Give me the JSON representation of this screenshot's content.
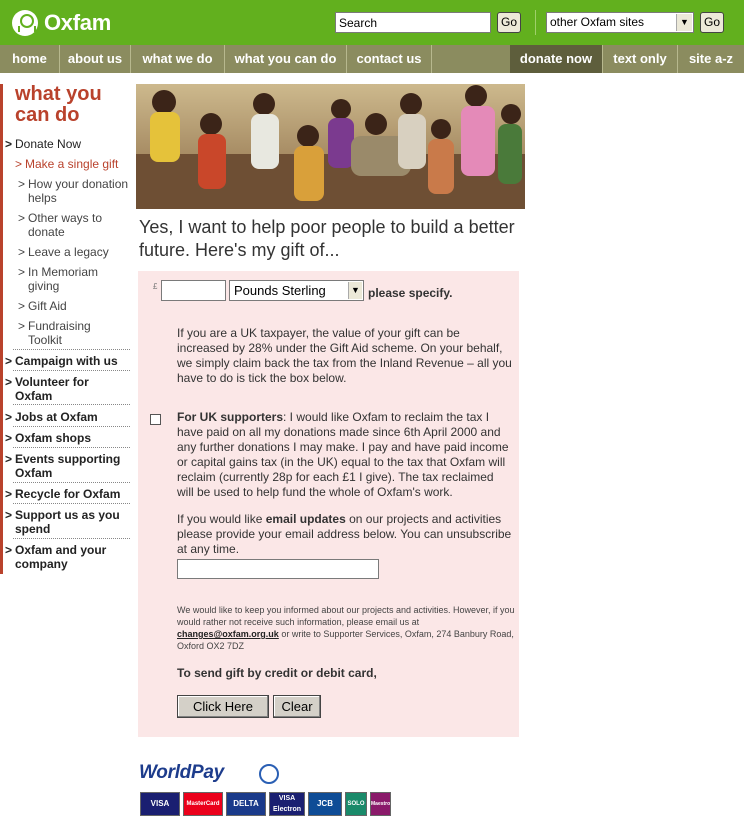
{
  "header": {
    "logo_text": "Oxfam",
    "search_placeholder": "Search",
    "go_label": "Go",
    "site_select_value": "other Oxfam sites",
    "go2_label": "Go"
  },
  "nav": {
    "items": [
      {
        "label": "home"
      },
      {
        "label": "about us"
      },
      {
        "label": "what we do"
      },
      {
        "label": "what you can do"
      },
      {
        "label": "contact us"
      },
      {
        "label": "donate now"
      },
      {
        "label": "text only"
      },
      {
        "label": "site a-z"
      }
    ]
  },
  "sidebar": {
    "title_line1": "what you",
    "title_line2": "can do",
    "donate_now": "Donate Now",
    "sub_items": [
      {
        "label": "Make a single gift"
      },
      {
        "label": "How your donation helps"
      },
      {
        "label": "Other ways to donate"
      },
      {
        "label": "Leave a legacy"
      },
      {
        "label": "In Memoriam giving"
      },
      {
        "label": "Gift Aid"
      },
      {
        "label": "Fundraising Toolkit"
      }
    ],
    "main_items": [
      {
        "label": "Campaign with us"
      },
      {
        "label": "Volunteer for Oxfam"
      },
      {
        "label": "Jobs at Oxfam"
      },
      {
        "label": "Oxfam shops"
      },
      {
        "label": "Events supporting Oxfam"
      },
      {
        "label": "Recycle for Oxfam"
      },
      {
        "label": "Support us as you spend"
      },
      {
        "label": "Oxfam and your company"
      }
    ]
  },
  "main": {
    "headline": "Yes, I want to help poor people to build a better future. Here's my gift of...",
    "currency_symbol": "£",
    "currency_value": "Pounds Sterling",
    "please_specify": "please specify.",
    "gift_aid_text": "If you are a UK taxpayer, the value of your gift can be increased by 28% under the Gift Aid scheme. On your behalf, we simply claim back the tax from the Inland Revenue – all you have to do is tick the box below.",
    "uk_supporters_label": "For UK supporters",
    "uk_supporters_text": ": I would like Oxfam to reclaim the tax I have paid on all my donations made since 6th April 2000 and any further donations I may make. I pay and have paid income or capital gains tax (in the UK) equal to the tax that Oxfam will reclaim (currently 28p for each £1 I give). The tax reclaimed will be used to help fund the whole of Oxfam's work.",
    "email_pre": "If you would like ",
    "email_bold": "email updates",
    "email_post": " on our projects and activities please provide your email address below. You can unsubscribe at any time.",
    "small_print_pre": "We would like to keep you informed about our projects and activities. However, if you would rather not receive such information, please email us at ",
    "small_print_email": "changes@oxfam.org.uk",
    "small_print_post": " or write to Supporter Services, Oxfam, 274 Banbury Road, Oxford OX2 7DZ",
    "send_label": "To send gift by credit or debit card,",
    "click_here_label": "Click Here",
    "clear_label": "Clear"
  },
  "footer": {
    "worldpay_text": "WorldPay",
    "cards": [
      {
        "label": "VISA",
        "color": "#1a1f71"
      },
      {
        "label": "MasterCard",
        "color": "#eb001b"
      },
      {
        "label": "DELTA",
        "color": "#1a3a8a"
      },
      {
        "label": "VISA Electron",
        "color": "#1a1f71"
      },
      {
        "label": "JCB",
        "color": "#0e4c96"
      },
      {
        "label": "SOLO",
        "color": "#1a8a6a"
      },
      {
        "label": "Maestro",
        "color": "#8a1a6a"
      }
    ]
  },
  "colors": {
    "brand_green": "#62b01e",
    "nav_olive": "#8b8c5f",
    "accent_rust": "#b9422c",
    "form_pink": "#fbe7e7"
  }
}
